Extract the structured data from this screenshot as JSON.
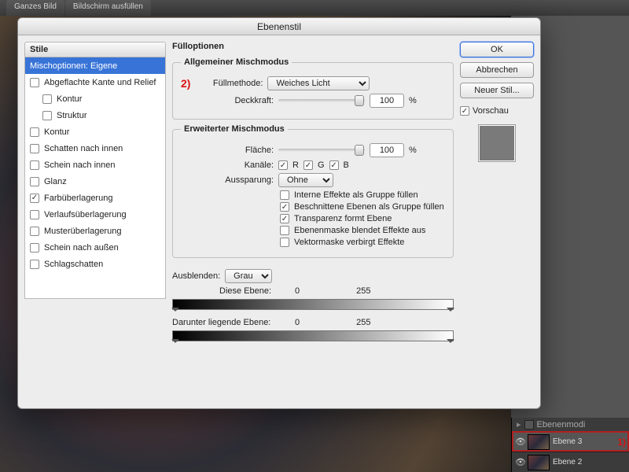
{
  "toolbar": {
    "ganzes_bild": "Ganzes Bild",
    "bildschirm": "Bildschirm ausfüllen"
  },
  "dialog": {
    "title": "Ebenenstil",
    "styles_header": "Stile",
    "style_rows": [
      {
        "label": "Mischoptionen: Eigene",
        "indent": false,
        "checkbox": false,
        "selected": true
      },
      {
        "label": "Abgeflachte Kante und Relief",
        "indent": false,
        "checkbox": true,
        "checked": false
      },
      {
        "label": "Kontur",
        "indent": true,
        "checkbox": true,
        "checked": false
      },
      {
        "label": "Struktur",
        "indent": true,
        "checkbox": true,
        "checked": false
      },
      {
        "label": "Kontur",
        "indent": false,
        "checkbox": true,
        "checked": false
      },
      {
        "label": "Schatten nach innen",
        "indent": false,
        "checkbox": true,
        "checked": false
      },
      {
        "label": "Schein nach innen",
        "indent": false,
        "checkbox": true,
        "checked": false
      },
      {
        "label": "Glanz",
        "indent": false,
        "checkbox": true,
        "checked": false
      },
      {
        "label": "Farbüberlagerung",
        "indent": false,
        "checkbox": true,
        "checked": true
      },
      {
        "label": "Verlaufsüberlagerung",
        "indent": false,
        "checkbox": true,
        "checked": false
      },
      {
        "label": "Musterüberlagerung",
        "indent": false,
        "checkbox": true,
        "checked": false
      },
      {
        "label": "Schein nach außen",
        "indent": false,
        "checkbox": true,
        "checked": false
      },
      {
        "label": "Schlagschatten",
        "indent": false,
        "checkbox": true,
        "checked": false
      }
    ],
    "fill_header": "Fülloptionen",
    "general": {
      "legend": "Allgemeiner Mischmodus",
      "mode_label": "Füllmethode:",
      "mode_value": "Weiches Licht",
      "opacity_label": "Deckkraft:",
      "opacity_value": "100",
      "pct": "%",
      "annotation": "2)"
    },
    "advanced": {
      "legend": "Erweiterter Mischmodus",
      "fill_label": "Fläche:",
      "fill_value": "100",
      "pct": "%",
      "channels_label": "Kanäle:",
      "ch_r": "R",
      "ch_g": "G",
      "ch_b": "B",
      "knockout_label": "Aussparung:",
      "knockout_value": "Ohne",
      "opts": [
        {
          "label": "Interne Effekte als Gruppe füllen",
          "checked": false
        },
        {
          "label": "Beschnittene Ebenen als Gruppe füllen",
          "checked": true
        },
        {
          "label": "Transparenz formt Ebene",
          "checked": true
        },
        {
          "label": "Ebenenmaske blendet Effekte aus",
          "checked": false
        },
        {
          "label": "Vektormaske verbirgt Effekte",
          "checked": false
        }
      ]
    },
    "blendif": {
      "label": "Ausblenden:",
      "value": "Grau",
      "this_label": "Diese Ebene:",
      "this_lo": "0",
      "this_hi": "255",
      "under_label": "Darunter liegende Ebene:",
      "under_lo": "0",
      "under_hi": "255"
    },
    "buttons": {
      "ok": "OK",
      "cancel": "Abbrechen",
      "new_style": "Neuer Stil...",
      "preview": "Vorschau"
    }
  },
  "layers": {
    "header": "Ebenenmodi",
    "rows": [
      {
        "name": "Ebene 3",
        "selected": true,
        "annotation": "1)"
      },
      {
        "name": "Ebene 2",
        "selected": false
      }
    ]
  }
}
